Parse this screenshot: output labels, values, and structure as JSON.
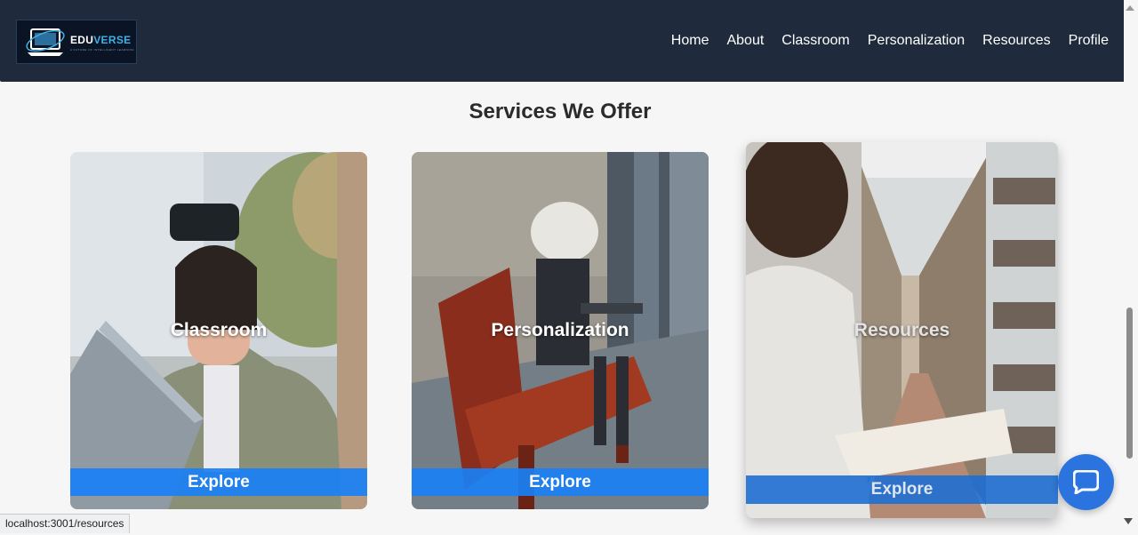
{
  "header": {
    "logo": {
      "name": "EDUVERSE",
      "name_part1": "EDU",
      "name_part2": "VERSE",
      "tagline": "A FUTURE OF INTELLIGENT LEARNING"
    },
    "nav": [
      {
        "label": "Home"
      },
      {
        "label": "About"
      },
      {
        "label": "Classroom"
      },
      {
        "label": "Personalization"
      },
      {
        "label": "Resources"
      },
      {
        "label": "Profile"
      }
    ]
  },
  "services": {
    "title": "Services We Offer",
    "cards": [
      {
        "title": "Classroom",
        "button": "Explore"
      },
      {
        "title": "Personalization",
        "button": "Explore"
      },
      {
        "title": "Resources",
        "button": "Explore"
      }
    ]
  },
  "chat": {
    "icon": "chat-bubble-icon"
  },
  "status_bar": {
    "url": "localhost:3001/resources"
  },
  "colors": {
    "navbar": "#1f2a3c",
    "accent": "#1a80f5",
    "chat": "#2b74e0",
    "logo_accent": "#41b0e6"
  }
}
